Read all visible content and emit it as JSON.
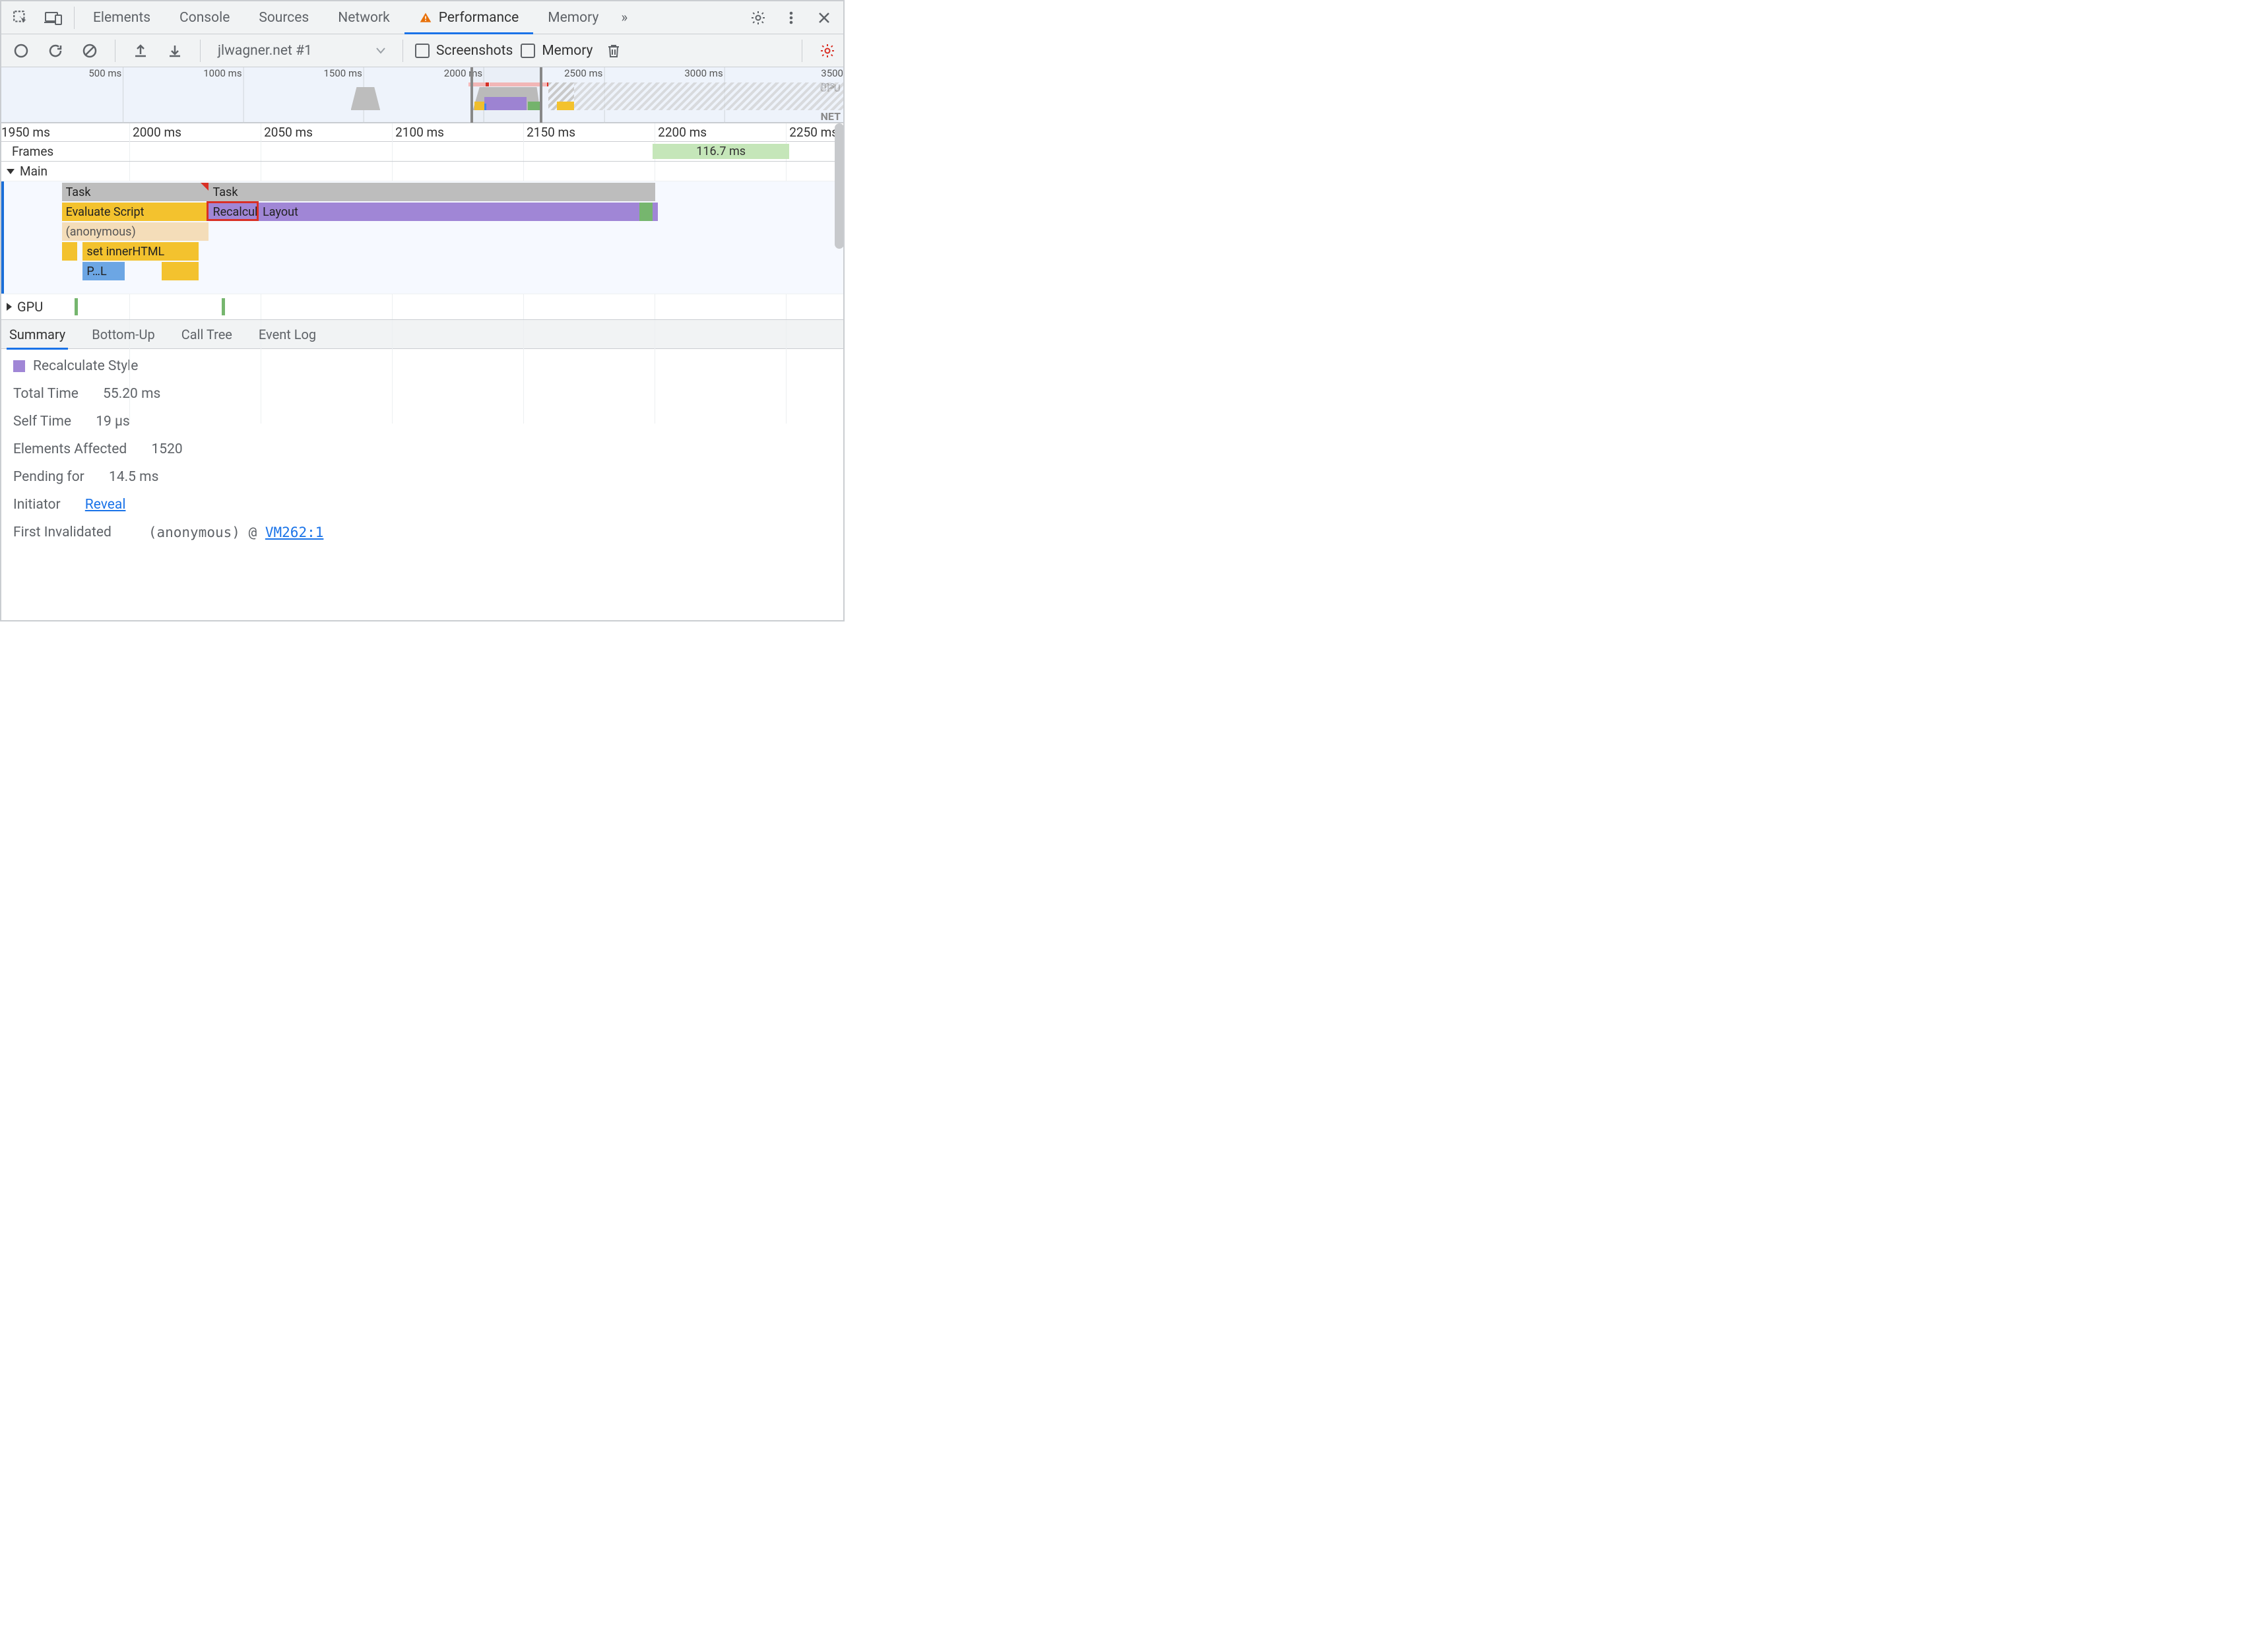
{
  "top_tabs": {
    "items": [
      "Elements",
      "Console",
      "Sources",
      "Network",
      "Performance",
      "Memory"
    ],
    "active_index": 4,
    "performance_has_warning": true,
    "more_label": "»"
  },
  "perf_toolbar": {
    "recording_dropdown": "jlwagner.net #1",
    "screenshots_label": "Screenshots",
    "memory_label": "Memory",
    "screenshots_checked": false,
    "memory_checked": false
  },
  "overview": {
    "ticks_ms": [
      500,
      1000,
      1500,
      2000,
      2500,
      3000,
      3500
    ],
    "lanes": [
      "CPU",
      "NET"
    ],
    "selection_start_ms": 1950,
    "selection_end_ms": 2250,
    "cpu_blocks": [
      {
        "start": 1490,
        "end": 1580,
        "type": "cpu-bump"
      },
      {
        "start": 1980,
        "end": 2040,
        "type": "script"
      },
      {
        "start": 2040,
        "end": 2260,
        "type": "layout"
      },
      {
        "start": 2260,
        "end": 2320,
        "type": "layout"
      },
      {
        "start": 2320,
        "end": 2380,
        "type": "script"
      }
    ],
    "net_empty_after_ms": 2380
  },
  "detail_ruler_ticks_ms": [
    1950,
    2000,
    2050,
    2100,
    2150,
    2200,
    2250
  ],
  "frames": {
    "label": "Frames",
    "chip_text": "116.7 ms",
    "chip_start_ms": 2198,
    "chip_end_ms": 2250
  },
  "tracks": {
    "main_label": "Main",
    "gpu_label": "GPU",
    "rows": [
      {
        "row": 0,
        "bars": [
          {
            "label": "Task",
            "kind": "task",
            "start": 1972,
            "end": 2028,
            "long": true
          },
          {
            "label": "Task",
            "kind": "task",
            "start": 2028,
            "end": 2198,
            "long": true,
            "long_from": 2044
          }
        ]
      },
      {
        "row": 1,
        "bars": [
          {
            "label": "Evaluate Script",
            "kind": "script",
            "start": 1972,
            "end": 2028
          },
          {
            "label": "Recalculate Style",
            "kind": "purple",
            "start": 2028,
            "end": 2047,
            "highlighted": true
          },
          {
            "label": "Layout",
            "kind": "purple",
            "start": 2047,
            "end": 2192
          },
          {
            "label": "",
            "kind": "green",
            "start": 2192,
            "end": 2197
          },
          {
            "label": "",
            "kind": "purple",
            "start": 2197,
            "end": 2199
          }
        ]
      },
      {
        "row": 2,
        "bars": [
          {
            "label": "(anonymous)",
            "kind": "tan",
            "start": 1972,
            "end": 2028
          }
        ]
      },
      {
        "row": 3,
        "bars": [
          {
            "label": "",
            "kind": "script",
            "start": 1972,
            "end": 1978
          },
          {
            "label": "set innerHTML",
            "kind": "script",
            "start": 1980,
            "end": 2024
          }
        ]
      },
      {
        "row": 4,
        "bars": [
          {
            "label": "P…L",
            "kind": "blue",
            "start": 1980,
            "end": 1996
          },
          {
            "label": "",
            "kind": "script",
            "start": 2010,
            "end": 2024
          }
        ]
      }
    ],
    "gpu_ticks_ms": [
      1978,
      2034
    ]
  },
  "bottom_tabs": {
    "items": [
      "Summary",
      "Bottom-Up",
      "Call Tree",
      "Event Log"
    ],
    "active_index": 0
  },
  "summary": {
    "title": "Recalculate Style",
    "rows": [
      {
        "label": "Total Time",
        "value": "55.20 ms"
      },
      {
        "label": "Self Time",
        "value": "19 µs"
      },
      {
        "label": "Elements Affected",
        "value": "1520"
      },
      {
        "label": "Pending for",
        "value": "14.5 ms"
      }
    ],
    "initiator_label": "Initiator",
    "initiator_link": "Reveal",
    "first_invalidated_label": "First Invalidated",
    "stack_text": "(anonymous)",
    "stack_at": "@",
    "stack_link": "VM262:1"
  },
  "colors": {
    "blue": "#1a73e8",
    "purple": "#a086d6",
    "script": "#f3c22e",
    "green": "#76b66e"
  }
}
